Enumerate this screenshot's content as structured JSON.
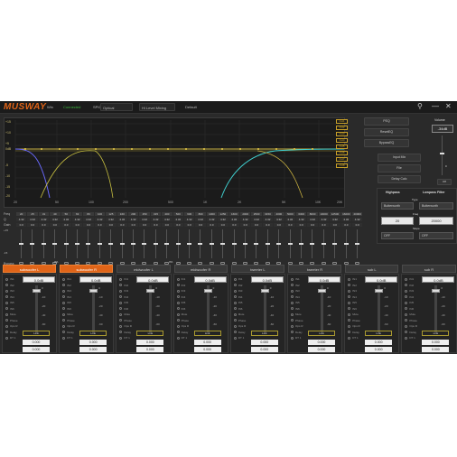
{
  "window": {
    "brand": "MUSWAY",
    "min_icon": "wifi-icon",
    "status": "Connected",
    "spdif_label": "SPIC",
    "spdif_value": "Optical",
    "hilevel": "Hi Level Mixing",
    "preset": "Default",
    "connected_color": "#3dbb3d",
    "accent": "#e06418"
  },
  "graph": {
    "yticks": [
      "+15",
      "+10",
      "+5",
      "0dB",
      "-5",
      "-10",
      "-15",
      "-20"
    ],
    "xticks": [
      "20",
      "50",
      "100",
      "200",
      "500",
      "1K",
      "2K",
      "5K",
      "10K",
      "20K"
    ],
    "legend": [
      "CH1",
      "CH2",
      "CH3",
      "CH4",
      "CH5",
      "CH6",
      "CH7",
      "CH8"
    ]
  },
  "right": {
    "buttons": [
      "PEQ",
      "ResetEQ",
      "BypassEQ"
    ],
    "volume_label": "Volume",
    "volume_value": "-34dB",
    "volume_level": 0.82,
    "zero_label": "0",
    "off_label": "Off",
    "actions": [
      "Input Mix",
      "File",
      "Delay Calc"
    ],
    "hp_title": "Highpass",
    "lp_title": "Lowpass Filter",
    "hp_type_label": "Type",
    "hp_type": "Butterworth",
    "lp_type": "Butterworth",
    "freq_label": "Freq",
    "hp_freq": "20",
    "lp_freq": "20000",
    "slope_label": "Slope",
    "hp_slope": "OFF",
    "lp_slope": "OFF"
  },
  "eq": {
    "row_labels": [
      "Freq",
      "Q",
      "Gain",
      "Bypass"
    ],
    "freqs": [
      "20",
      "25",
      "31",
      "40",
      "50",
      "63",
      "80",
      "100",
      "125",
      "160",
      "200",
      "250",
      "315",
      "400",
      "500",
      "630",
      "800",
      "1000",
      "1250",
      "1600",
      "2000",
      "2500",
      "3150",
      "4000",
      "5000",
      "6300",
      "8000",
      "10000",
      "12500",
      "16000",
      "20000"
    ],
    "q": "4.32",
    "gain": "0.0",
    "top_gain": "+15",
    "bot_gain": "-15"
  },
  "channels": [
    {
      "name": "subwoofer L",
      "active": true,
      "volume": "0.0dB",
      "link": "Link",
      "delay": "0.000",
      "level": 0.0
    },
    {
      "name": "subwoofer R",
      "active": true,
      "volume": "0.0dB",
      "link": "Link",
      "delay": "0.000",
      "level": 0.0
    },
    {
      "name": "midwoofer L",
      "active": false,
      "volume": "0.0dB",
      "link": "Link",
      "delay": "0.000",
      "level": 0.0
    },
    {
      "name": "midwoofer R",
      "active": false,
      "volume": "0.0dB",
      "link": "Link",
      "delay": "0.000",
      "level": 0.0
    },
    {
      "name": "tweeter L",
      "active": false,
      "volume": "0.0dB",
      "link": "Link",
      "delay": "0.000",
      "level": 0.0
    },
    {
      "name": "tweeter R",
      "active": false,
      "volume": "0.0dB",
      "link": "Link",
      "delay": "0.000",
      "level": 0.0
    },
    {
      "name": "sub L",
      "active": false,
      "volume": "0.0dB",
      "link": "Link",
      "delay": "0.000",
      "level": 0.0
    },
    {
      "name": "sub R",
      "active": false,
      "volume": "0.0dB",
      "link": "Link",
      "delay": "0.000",
      "level": 0.0
    }
  ],
  "channel_rows": [
    "IN1",
    "IN2",
    "IN3",
    "IN4",
    "IN5",
    "IN6",
    "Mute",
    "Phase",
    "Ops R",
    "Delay",
    "DT 1"
  ],
  "channel_scale": [
    "0",
    "-10",
    "-20",
    "-40",
    "-60"
  ],
  "pct": "0%"
}
